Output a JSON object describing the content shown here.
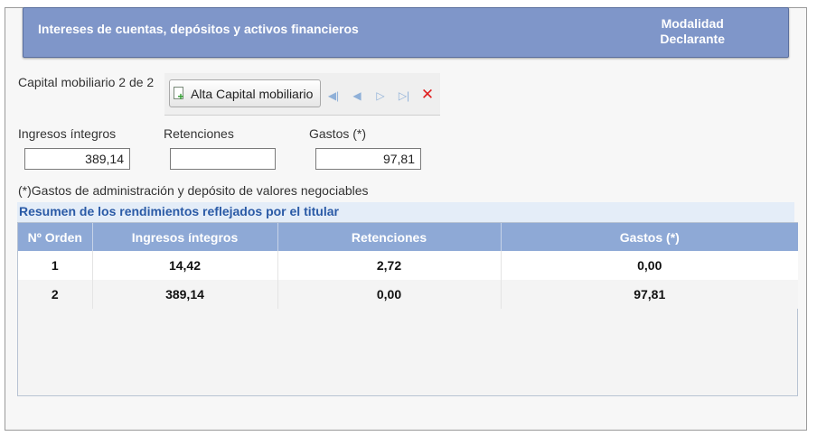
{
  "header": {
    "title": "Intereses de cuentas, depósitos y activos financieros",
    "modalidad_line1": "Modalidad",
    "modalidad_line2": "Declarante"
  },
  "record": {
    "counter_label": "Capital mobiliario 2 de 2"
  },
  "toolbar": {
    "alta_label": "Alta Capital mobiliario",
    "icons": [
      "add-document-icon",
      "first-record-icon",
      "previous-record-icon",
      "next-record-icon",
      "last-record-icon",
      "delete-icon"
    ]
  },
  "fields": {
    "ingresos": {
      "label": "Ingresos íntegros",
      "value": "389,14"
    },
    "retenciones": {
      "label": "Retenciones",
      "value": ""
    },
    "gastos": {
      "label": "Gastos (*)",
      "value": "97,81"
    }
  },
  "note": "(*)Gastos de administración y depósito de valores negociables",
  "summary": {
    "title": "Resumen de los rendimientos reflejados por el titular",
    "columns": [
      "Nº Orden",
      "Ingresos íntegros",
      "Retenciones",
      "Gastos (*)"
    ],
    "rows": [
      [
        "1",
        "14,42",
        "2,72",
        "0,00"
      ],
      [
        "2",
        "389,14",
        "0,00",
        "97,81"
      ]
    ]
  },
  "colors": {
    "header_bg": "#7f96c9",
    "table_header_bg": "#8ea9d6",
    "summary_title": "#2a5aa6",
    "delete_icon": "#e02020"
  }
}
